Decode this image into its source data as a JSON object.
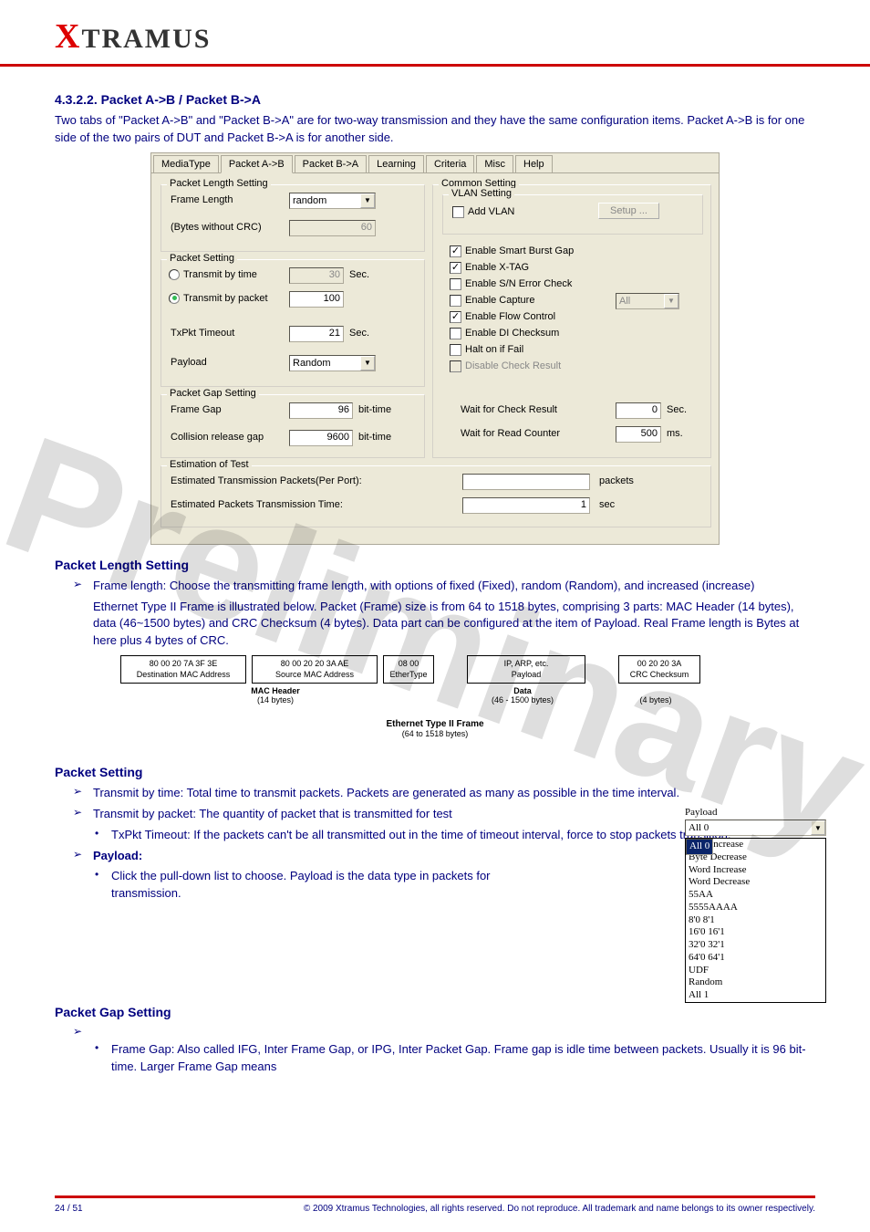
{
  "header": {
    "logo_prefix": "X",
    "logo_rest": "TRAMUS"
  },
  "section_heading": "4.3.2.2. Packet A->B / Packet B->A",
  "intro_text": "Two tabs of \"Packet A->B\" and \"Packet B->A\" are for two-way transmission and they have the same configuration items. Packet A->B is for one side of the two pairs of DUT and Packet B->A is for another side.",
  "tabs": [
    "MediaType",
    "Packet A->B",
    "Packet B->A",
    "Learning",
    "Criteria",
    "Misc",
    "Help"
  ],
  "active_tab": 1,
  "pls": {
    "legend": "Packet Length Setting",
    "frame_length_lbl": "Frame Length",
    "frame_length_val": "random",
    "bytes_lbl": "(Bytes without CRC)",
    "bytes_val": "60"
  },
  "ps": {
    "legend": "Packet Setting",
    "t_time": "Transmit by time",
    "t_time_val": "30",
    "t_time_unit": "Sec.",
    "t_packet": "Transmit by packet",
    "t_packet_val": "100",
    "txpkt": "TxPkt Timeout",
    "txpkt_val": "21",
    "txpkt_unit": "Sec.",
    "payload": "Payload",
    "payload_val": "Random"
  },
  "pgs": {
    "legend": "Packet Gap Setting",
    "frame_gap": "Frame Gap",
    "frame_gap_val": "96",
    "frame_gap_unit": "bit-time",
    "coll": "Collision release gap",
    "coll_val": "9600",
    "coll_unit": "bit-time"
  },
  "cs": {
    "legend": "Common Setting",
    "vlan_legend": "VLAN Setting",
    "add_vlan": "Add VLAN",
    "setup": "Setup ...",
    "opts": {
      "sbg": "Enable Smart Burst Gap",
      "xtag": "Enable X-TAG",
      "sn": "Enable S/N Error Check",
      "cap": "Enable Capture",
      "cap_val": "All",
      "flow": "Enable Flow Control",
      "di": "Enable DI Checksum",
      "halt": "Halt on if Fail",
      "dcr": "Disable Check Result"
    },
    "wait_chk": "Wait for Check Result",
    "wait_chk_val": "0",
    "wait_chk_unit": "Sec.",
    "wait_rd": "Wait for Read Counter",
    "wait_rd_val": "500",
    "wait_rd_unit": "ms."
  },
  "est": {
    "legend": "Estimation of Test",
    "etpp": "Estimated Transmission Packets(Per Port):",
    "etpp_val": "",
    "etpp_unit": "packets",
    "eptt": "Estimated Packets Transmission Time:",
    "eptt_val": "1",
    "eptt_unit": "sec"
  },
  "pls_heading": "Packet Length Setting",
  "pls_bullet": "Frame length: Choose the transmitting frame length, with options of fixed (Fixed), random (Random), and increased (increase)",
  "pls_para": "Ethernet Type II Frame is illustrated below. Packet (Frame) size is from 64 to 1518 bytes, comprising 3 parts: MAC Header (14 bytes), data (46~1500 bytes) and CRC Checksum (4 bytes). Data part can be configured at the item of Payload. Real Frame length is Bytes at here plus 4 bytes of CRC.",
  "fd": {
    "dmac_hex": "80 00 20 7A 3F 3E",
    "dmac_lbl": "Destination MAC Address",
    "smac_hex": "80 00 20 20 3A AE",
    "smac_lbl": "Source MAC Address",
    "et_hex": "08 00",
    "et_lbl": "EtherType",
    "pl_lbl1": "IP, ARP, etc.",
    "pl_lbl2": "Payload",
    "crc_hex": "00 20 20 3A",
    "crc_lbl": "CRC Checksum",
    "mh1": "MAC Header",
    "mh2": "(14 bytes)",
    "d1": "Data",
    "d2": "(46 - 1500 bytes)",
    "c2": "(4 bytes)",
    "t1": "Ethernet Type II Frame",
    "t2": "(64 to 1518 bytes)"
  },
  "ps_heading": "Packet Setting",
  "payload_heading": "Payload:",
  "payload_lbl": "Payload",
  "payload_selected": "All 0",
  "payload_opts": [
    "All 0",
    "Byte Increase",
    "Byte Decrease",
    "Word Increase",
    "Word Decrease",
    "55AA",
    "5555AAAA",
    "8'0 8'1",
    "16'0 16'1",
    "32'0 32'1",
    "64'0 64'1",
    "UDF",
    "Random",
    "All 1"
  ],
  "ps_bullets": [
    "Transmit by time: Total time to transmit packets. Packets are generated as many as possible in the time interval.",
    "Transmit by packet: The quantity of packet that is transmitted for test",
    "TxPkt Timeout: If the packets can't be all transmitted out in the time of timeout interval, force to stop packets transition.",
    "Click the pull-down list to choose. Payload is the data type in packets for transmission."
  ],
  "pgs_heading": "Packet Gap Setting",
  "pgs_bullets": [
    "Frame Gap: Also called IFG, Inter Frame Gap, or IPG, Inter Packet Gap. Frame gap is idle time between packets. Usually it is 96 bit-time. Larger Frame Gap means"
  ],
  "footer": {
    "left": "24 / 51",
    "right": "© 2009 Xtramus Technologies, all rights reserved. Do not reproduce. All trademark and name belongs to its owner respectively."
  },
  "watermark": "Preliminary"
}
